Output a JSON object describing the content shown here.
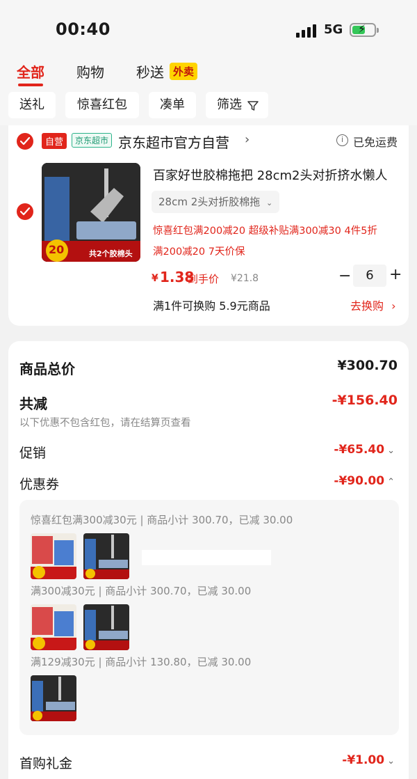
{
  "status_bar": {
    "time": "00:40",
    "network": "5G"
  },
  "tabs": [
    {
      "label": "全部",
      "active": true
    },
    {
      "label": "购物",
      "active": false
    },
    {
      "label": "秒送",
      "active": false
    }
  ],
  "tab_badge": "外卖",
  "filters": [
    "送礼",
    "惊喜红包",
    "凑单",
    "筛选"
  ],
  "store": {
    "tag_self": "自营",
    "tag_market": "京东超市",
    "name": "京东超市官方自营",
    "shipping": "已免运费"
  },
  "product": {
    "title": "百家好世胶棉拖把 28cm2头对折挤水懒人",
    "sku": "28cm 2头对折胶棉拖",
    "promos_line1": "惊喜红包满200减20   超级补贴满300减30   4件5折",
    "promos_line2": "满200减20   7天价保",
    "currency": "¥",
    "price": "1.38",
    "price_label": "到手价",
    "original_price": "¥21.8",
    "quantity": "6",
    "swap_text": "满1件可换购 5.9元商品",
    "swap_link": "去换购",
    "image_badge": "20",
    "image_caption": "共2个胶棉头"
  },
  "summary": {
    "total_label": "商品总价",
    "total_value": "¥300.70",
    "discount_label": "共减",
    "discount_value": "-¥156.40",
    "discount_note": "以下优惠不包含红包，请在结算页查看",
    "promo_label": "促销",
    "promo_value": "-¥65.40",
    "coupon_label": "优惠券",
    "coupon_value": "-¥90.00",
    "coupon_lines": [
      "惊喜红包满300减30元 | 商品小计 300.70，已减 30.00",
      "满300减30元 | 商品小计 300.70，已减 30.00",
      "满129减30元 | 商品小计 130.80，已减 30.00"
    ],
    "first_gift_label": "首购礼金",
    "first_gift_value": "-¥1.00"
  },
  "colors": {
    "accent": "#e1251b",
    "badge_yellow": "#ffd400",
    "market_green": "#2bb38a",
    "battery_green": "#35c759"
  }
}
